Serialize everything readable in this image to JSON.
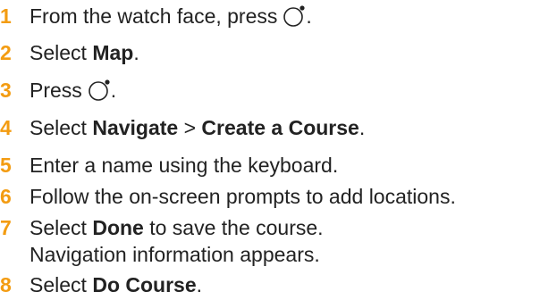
{
  "accent_color": "#f39c12",
  "steps": [
    {
      "num": "1",
      "text": "From the watch face, press",
      "suffix": ".",
      "icon": "watch-button-icon"
    },
    {
      "num": "2",
      "pre": "Select ",
      "bold": "Map",
      "post": "."
    },
    {
      "num": "3",
      "text": "Press",
      "suffix": ".",
      "icon": "watch-button-icon"
    },
    {
      "num": "4",
      "pre": "Select ",
      "bold": "Navigate",
      "mid": " > ",
      "bold2": "Create a Course",
      "post": "."
    },
    {
      "num": "5",
      "text": "Enter a name using the keyboard."
    },
    {
      "num": "6",
      "text": "Follow the on-screen prompts to add locations."
    },
    {
      "num": "7",
      "pre": "Select ",
      "bold": "Done",
      "post": " to save the course.",
      "note": "Navigation information appears."
    },
    {
      "num": "8",
      "pre": "Select ",
      "bold": "Do Course",
      "post": "."
    }
  ]
}
